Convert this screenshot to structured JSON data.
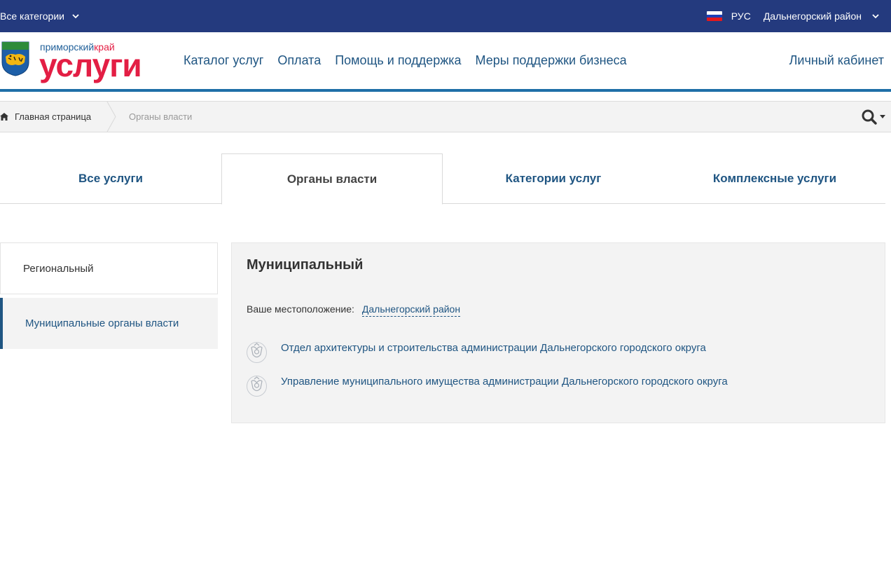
{
  "topbar": {
    "all_categories": "Все категории",
    "language": "РУС",
    "region": "Дальнегорский район",
    "flag_colors": [
      "#ffffff",
      "#1c3fb7",
      "#e4181c"
    ]
  },
  "header": {
    "logo_line1_a": "приморский",
    "logo_line1_b": "край",
    "logo_line2": "услуги",
    "nav": [
      "Каталог услуг",
      "Оплата",
      "Помощь и поддержка",
      "Меры поддержки бизнеса"
    ],
    "cabinet": "Личный кабинет"
  },
  "breadcrumb": {
    "home": "Главная страница",
    "current": "Органы власти"
  },
  "tabs": [
    "Все услуги",
    "Органы власти",
    "Категории услуг",
    "Комплексные услуги"
  ],
  "active_tab": "Органы власти",
  "sidebar": {
    "items": [
      {
        "label": "Региональный",
        "active": false
      },
      {
        "label": "Муниципальные органы власти",
        "active": true
      }
    ]
  },
  "content": {
    "title": "Муниципальный",
    "location_label": "Ваше местоположение:",
    "location_value": "Дальнегорский район",
    "organizations": [
      "Отдел архитектуры и строительства администрации Дальнегорского городского округа",
      "Управление муниципального имущества администрации Дальнегорского городского округа"
    ]
  },
  "colors": {
    "topbar": "#243a7e",
    "accent": "#1f5582",
    "logo_red": "#e31e44"
  }
}
